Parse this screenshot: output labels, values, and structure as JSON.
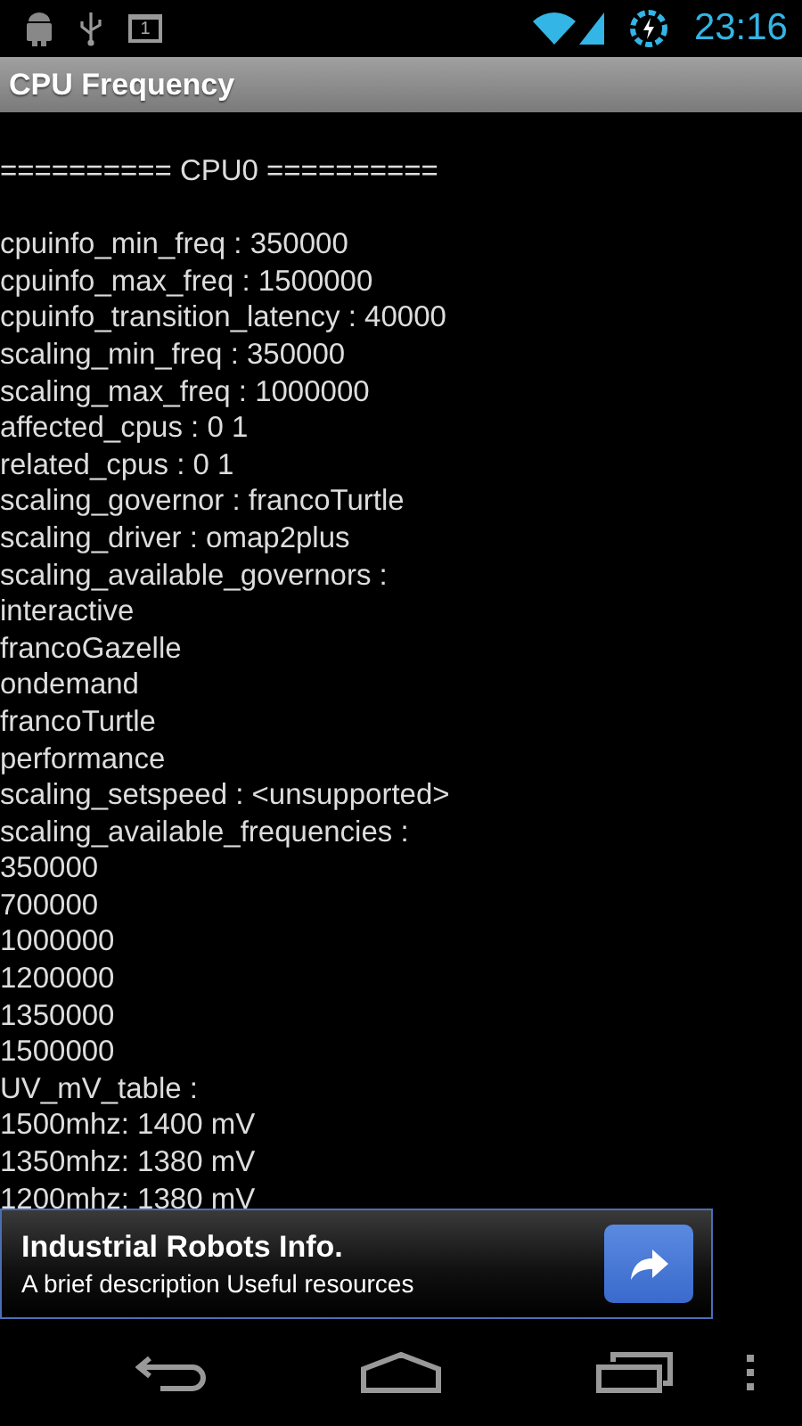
{
  "status_bar": {
    "notification_count": "1",
    "time": "23:16"
  },
  "title_bar": {
    "title": "CPU Frequency"
  },
  "content": {
    "header": "========== CPU0 ==========",
    "lines": [
      "cpuinfo_min_freq : 350000",
      "cpuinfo_max_freq : 1500000",
      "cpuinfo_transition_latency : 40000",
      "scaling_min_freq : 350000",
      "scaling_max_freq : 1000000",
      "affected_cpus : 0 1",
      "related_cpus : 0 1",
      "scaling_governor : francoTurtle",
      "scaling_driver : omap2plus",
      "scaling_available_governors :",
      "interactive",
      "francoGazelle",
      "ondemand",
      "francoTurtle",
      "performance",
      "scaling_setspeed : <unsupported>",
      "scaling_available_frequencies :",
      "350000",
      "700000",
      "1000000",
      "1200000",
      "1350000",
      "1500000",
      "UV_mV_table :",
      "1500mhz: 1400 mV",
      "1350mhz: 1380 mV",
      "1200mhz: 1380 mV"
    ]
  },
  "ad_banner": {
    "title": "Industrial Robots Info.",
    "description": "A brief description Useful resources"
  }
}
